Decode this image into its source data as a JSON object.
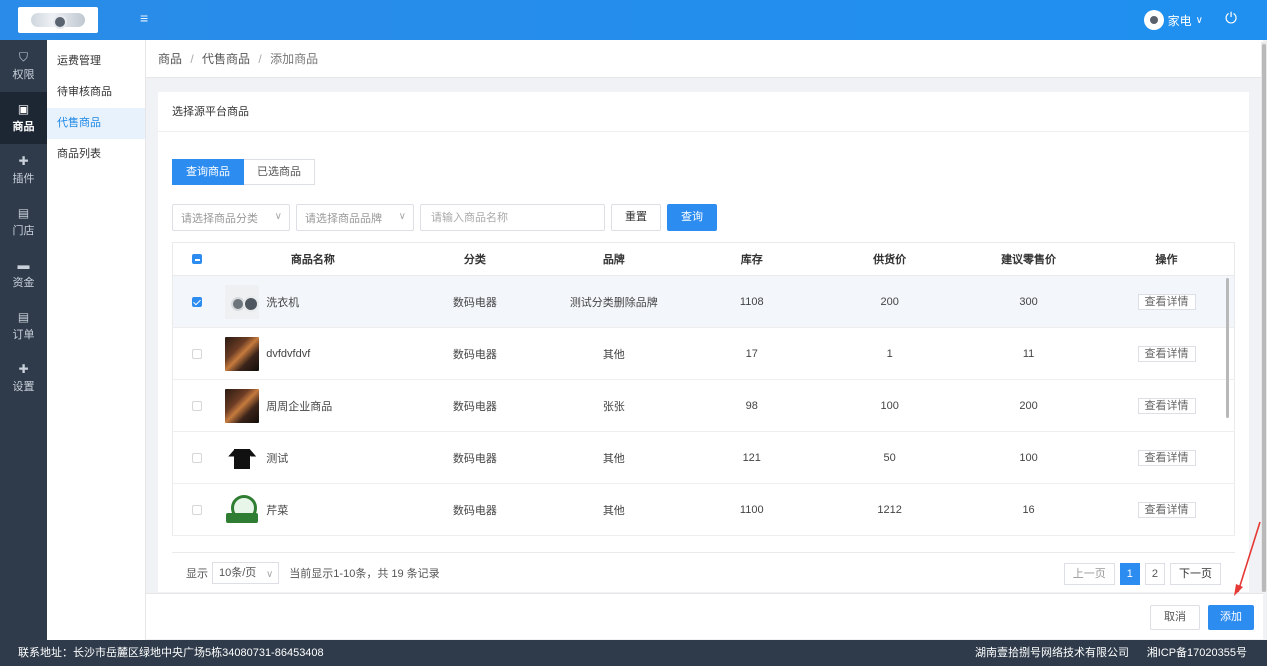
{
  "header": {
    "user_name": "家电",
    "user_caret": "∨",
    "menu_icon": "hamburger-icon",
    "power_icon": "power-icon"
  },
  "iconbar": [
    {
      "label": "权限",
      "icon": "shield-icon"
    },
    {
      "label": "商品",
      "icon": "box-icon",
      "active": true
    },
    {
      "label": "插件",
      "icon": "puzzle-icon"
    },
    {
      "label": "门店",
      "icon": "store-icon"
    },
    {
      "label": "资金",
      "icon": "wallet-icon"
    },
    {
      "label": "订单",
      "icon": "document-icon"
    },
    {
      "label": "设置",
      "icon": "puzzle-icon"
    }
  ],
  "submenu": [
    {
      "label": "运费管理"
    },
    {
      "label": "待审核商品"
    },
    {
      "label": "代售商品",
      "active": true
    },
    {
      "label": "商品列表"
    }
  ],
  "breadcrumb": [
    "商品",
    "代售商品",
    "添加商品"
  ],
  "breadcrumb_sep": "/",
  "card": {
    "title": "选择源平台商品",
    "tabs": [
      "查询商品",
      "已选商品"
    ],
    "filters": {
      "category_placeholder": "请选择商品分类",
      "brand_placeholder": "请选择商品品牌",
      "name_placeholder": "请输入商品名称",
      "reset": "重置",
      "search": "查询"
    }
  },
  "table": {
    "headers": [
      "商品名称",
      "分类",
      "品牌",
      "库存",
      "供货价",
      "建议零售价",
      "操作"
    ],
    "rows": [
      {
        "name": "洗衣机",
        "category": "数码电器",
        "brand": "测试分类删除品牌",
        "stock": "1108",
        "supply": "200",
        "retail": "300",
        "action": "查看详情",
        "checked": true,
        "thumb": "washer"
      },
      {
        "name": "dvfdvfdvf",
        "category": "数码电器",
        "brand": "其他",
        "stock": "17",
        "supply": "1",
        "retail": "11",
        "action": "查看详情",
        "checked": false,
        "thumb": "photo"
      },
      {
        "name": "周周企业商品",
        "category": "数码电器",
        "brand": "张张",
        "stock": "98",
        "supply": "100",
        "retail": "200",
        "action": "查看详情",
        "checked": false,
        "thumb": "photo"
      },
      {
        "name": "测试",
        "category": "数码电器",
        "brand": "其他",
        "stock": "121",
        "supply": "50",
        "retail": "100",
        "action": "查看详情",
        "checked": false,
        "thumb": "tshirt"
      },
      {
        "name": "芹菜",
        "category": "数码电器",
        "brand": "其他",
        "stock": "1100",
        "supply": "1212",
        "retail": "16",
        "action": "查看详情",
        "checked": false,
        "thumb": "approved"
      }
    ]
  },
  "pagination": {
    "show_label": "显示",
    "page_size": "10条/页",
    "summary": "当前显示1-10条，共 19 条记录",
    "prev": "上一页",
    "pages": [
      "1",
      "2"
    ],
    "current": "1",
    "next": "下一页"
  },
  "actions": {
    "cancel": "取消",
    "add": "添加"
  },
  "footer": {
    "address": "联系地址：长沙市岳麓区绿地中央广场5栋34080731-86453408",
    "company": "湖南壹拾捌号网络技术有限公司",
    "icp": "湘ICP备17020355号"
  },
  "colors": {
    "primary": "#2d8cf0",
    "topbar": "#1f90f0",
    "sidebar": "#2f3b4a",
    "annotation_arrow": "#e53935"
  }
}
